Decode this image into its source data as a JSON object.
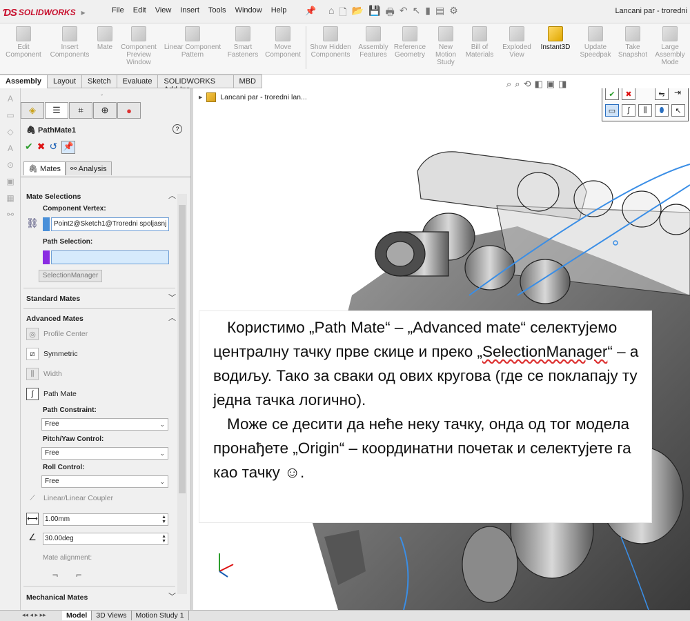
{
  "app": {
    "logo": "SOLIDWORKS",
    "window_title": "Lancani par - troredni",
    "menu": [
      "File",
      "Edit",
      "View",
      "Insert",
      "Tools",
      "Window",
      "Help"
    ]
  },
  "ribbon": [
    {
      "label": "Edit Component",
      "icon": "edit-component-icon"
    },
    {
      "label": "Insert Components",
      "icon": "insert-components-icon"
    },
    {
      "label": "Mate",
      "icon": "mate-icon"
    },
    {
      "label": "Component Preview Window",
      "icon": "preview-window-icon"
    },
    {
      "label": "Linear Component Pattern",
      "icon": "pattern-icon"
    },
    {
      "label": "Smart Fasteners",
      "icon": "fasteners-icon"
    },
    {
      "label": "Move Component",
      "icon": "move-component-icon"
    },
    {
      "label": "Show Hidden Components",
      "icon": "show-hidden-icon"
    },
    {
      "label": "Assembly Features",
      "icon": "assembly-features-icon"
    },
    {
      "label": "Reference Geometry",
      "icon": "reference-geometry-icon"
    },
    {
      "label": "New Motion Study",
      "icon": "motion-study-icon"
    },
    {
      "label": "Bill of Materials",
      "icon": "bom-icon"
    },
    {
      "label": "Exploded View",
      "icon": "exploded-view-icon"
    },
    {
      "label": "Instant3D",
      "icon": "instant3d-icon",
      "active": true
    },
    {
      "label": "Update Speedpak",
      "icon": "speedpak-icon"
    },
    {
      "label": "Take Snapshot",
      "icon": "snapshot-icon"
    },
    {
      "label": "Large Assembly Mode",
      "icon": "large-assembly-icon"
    }
  ],
  "command_tabs": [
    "Assembly",
    "Layout",
    "Sketch",
    "Evaluate",
    "SOLIDWORKS Add-Ins",
    "MBD"
  ],
  "property_manager": {
    "title": "PathMate1",
    "subtabs": [
      "Mates",
      "Analysis"
    ],
    "mate_selections": {
      "header": "Mate Selections",
      "component_vertex_label": "Component Vertex:",
      "component_vertex_value": "Point2@Sketch1@Troredni spoljasnj",
      "path_selection_label": "Path Selection:",
      "path_selection_value": "",
      "selection_manager_button": "SelectionManager"
    },
    "standard_mates_header": "Standard Mates",
    "advanced_mates_header": "Advanced Mates",
    "advanced_mates": {
      "profile_center": "Profile Center",
      "symmetric": "Symmetric",
      "width": "Width",
      "path_mate": "Path Mate"
    },
    "path_constraint_label": "Path Constraint:",
    "path_constraint_value": "Free",
    "pitch_yaw_label": "Pitch/Yaw Control:",
    "pitch_yaw_value": "Free",
    "roll_label": "Roll Control:",
    "roll_value": "Free",
    "linear_coupler_label": "Linear/Linear Coupler",
    "distance_value": "1.00mm",
    "angle_value": "30.00deg",
    "mate_alignment_label": "Mate alignment:",
    "mechanical_mates_header": "Mechanical Mates"
  },
  "viewport": {
    "tree_label": "Lancani par - troredni lan..."
  },
  "bottom_tabs": [
    "Model",
    "3D Views",
    "Motion Study 1"
  ],
  "note": {
    "p1_a": "Користимо „Path Mate“ – „Advanced mate“ селектујемо централну тачку прве скице и преко „",
    "p1_b": "SelectionManager",
    "p1_c": "“ – а водиљу. Тако за сваки од ових кругова (где се поклапају ту једна тачка логично).",
    "p2": "Може се десити да неће неку тачку, онда од тог модела пронађете „Origin“ – координатни почетак и селектујете га као тачку ☺."
  },
  "colors": {
    "brand": "#c8102e",
    "accent": "#1a5fb4",
    "ok": "#2e9e2e",
    "cancel": "#dd1111",
    "path_selection_color": "#8a2be2",
    "vertex_selection_color": "#4a90d9",
    "chain_path": "#3a8ee6"
  }
}
